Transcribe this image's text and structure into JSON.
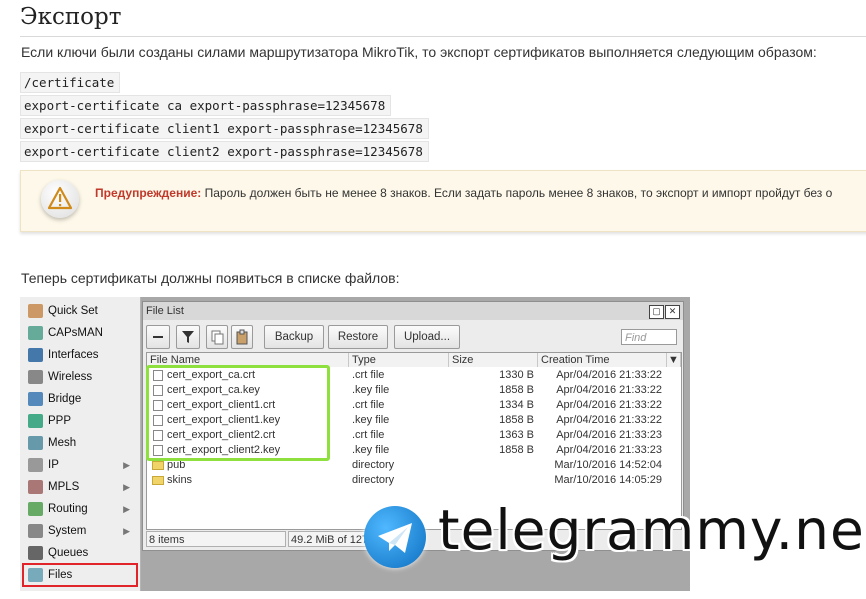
{
  "heading": "Экспорт",
  "intro": "Если ключи были созданы силами маршрутизатора MikroTik, то экспорт сертификатов выполняется следующим образом:",
  "code_lines": [
    "/certificate",
    "export-certificate ca export-passphrase=12345678",
    "export-certificate client1 export-passphrase=12345678",
    "export-certificate client2 export-passphrase=12345678"
  ],
  "warning": {
    "label": "Предупреждение:",
    "text": "Пароль должен быть не менее 8 знаков. Если задать пароль менее 8 знаков, то экспорт и импорт пройдут без о"
  },
  "after_text": "Теперь сертификаты должны появиться в списке файлов:",
  "winbox": {
    "menu": [
      {
        "label": "Quick Set",
        "icon": "quick-set-icon",
        "arrow": false
      },
      {
        "label": "CAPsMAN",
        "icon": "capsman-icon",
        "arrow": false
      },
      {
        "label": "Interfaces",
        "icon": "interfaces-icon",
        "arrow": false
      },
      {
        "label": "Wireless",
        "icon": "wireless-icon",
        "arrow": false
      },
      {
        "label": "Bridge",
        "icon": "bridge-icon",
        "arrow": false
      },
      {
        "label": "PPP",
        "icon": "ppp-icon",
        "arrow": false
      },
      {
        "label": "Mesh",
        "icon": "mesh-icon",
        "arrow": false
      },
      {
        "label": "IP",
        "icon": "ip-icon",
        "arrow": true
      },
      {
        "label": "MPLS",
        "icon": "mpls-icon",
        "arrow": true
      },
      {
        "label": "Routing",
        "icon": "routing-icon",
        "arrow": true
      },
      {
        "label": "System",
        "icon": "system-icon",
        "arrow": true
      },
      {
        "label": "Queues",
        "icon": "queues-icon",
        "arrow": false
      },
      {
        "label": "Files",
        "icon": "files-icon",
        "arrow": false
      }
    ],
    "file_list": {
      "title": "File List",
      "buttons": {
        "backup": "Backup",
        "restore": "Restore",
        "upload": "Upload..."
      },
      "find_placeholder": "Find",
      "columns": [
        "File Name",
        "Type",
        "Size",
        "Creation Time"
      ],
      "rows": [
        {
          "name": "cert_export_ca.crt",
          "type": ".crt file",
          "size": "1330 B",
          "time": "Apr/04/2016 21:33:22",
          "kind": "file"
        },
        {
          "name": "cert_export_ca.key",
          "type": ".key file",
          "size": "1858 B",
          "time": "Apr/04/2016 21:33:22",
          "kind": "file"
        },
        {
          "name": "cert_export_client1.crt",
          "type": ".crt file",
          "size": "1334 B",
          "time": "Apr/04/2016 21:33:22",
          "kind": "file"
        },
        {
          "name": "cert_export_client1.key",
          "type": ".key file",
          "size": "1858 B",
          "time": "Apr/04/2016 21:33:22",
          "kind": "file"
        },
        {
          "name": "cert_export_client2.crt",
          "type": ".crt file",
          "size": "1363 B",
          "time": "Apr/04/2016 21:33:23",
          "kind": "file"
        },
        {
          "name": "cert_export_client2.key",
          "type": ".key file",
          "size": "1858 B",
          "time": "Apr/04/2016 21:33:23",
          "kind": "file"
        },
        {
          "name": "pub",
          "type": "directory",
          "size": "",
          "time": "Mar/10/2016 14:52:04",
          "kind": "dir"
        },
        {
          "name": "skins",
          "type": "directory",
          "size": "",
          "time": "Mar/10/2016 14:05:29",
          "kind": "dir"
        }
      ],
      "status": {
        "items": "8 items",
        "disk": "49.2 MiB of 127"
      }
    }
  },
  "watermark": "telegrammy.net"
}
